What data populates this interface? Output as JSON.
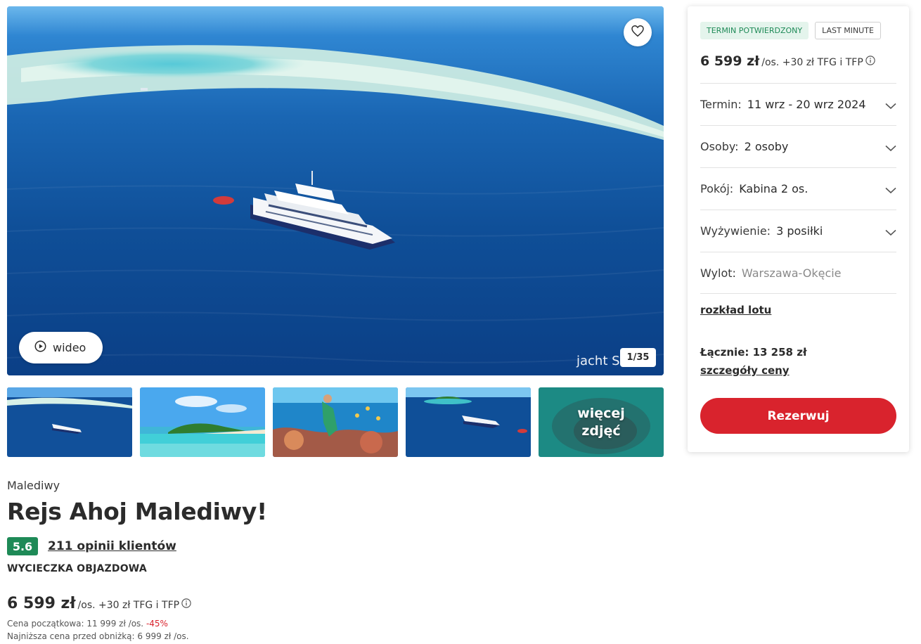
{
  "gallery": {
    "favorite_icon": "heart-icon",
    "video_icon": "play-circle-icon",
    "video_label": "wideo",
    "watermark": "jacht Sh",
    "counter": "1/35",
    "more_label": "więcej zdjęć",
    "thumbnails": [
      "yacht-aerial",
      "tropical-island",
      "snorkeling-reef",
      "yacht-near-island",
      "more-photos"
    ]
  },
  "listing": {
    "country": "Malediwy",
    "title": "Rejs Ahoj Malediwy!",
    "rating": "5.6",
    "reviews": "211 opinii klientów",
    "trip_type": "WYCIECZKA OBJAZDOWA",
    "price": "6 599 zł",
    "price_suffix": "/os. +30 zł TFG i TFP",
    "price_info_icon": "info-icon",
    "original_price": "Cena początkowa: 11 999 zł /os.",
    "discount": "-45%",
    "lowest_price": "Najniższa cena przed obniżką: 6 999 zł /os."
  },
  "booking": {
    "badge_confirmed": "TERMIN POTWIERDZONY",
    "badge_last_minute": "LAST MINUTE",
    "price": "6 599 zł",
    "price_suffix": "/os. +30 zł TFG i TFP",
    "options": [
      {
        "label": "Termin:",
        "value": "11 wrz - 20 wrz 2024",
        "dropdown": true
      },
      {
        "label": "Osoby:",
        "value": "2 osoby",
        "dropdown": true
      },
      {
        "label": "Pokój:",
        "value": "Kabina 2 os.",
        "dropdown": true
      },
      {
        "label": "Wyżywienie:",
        "value": "3 posiłki",
        "dropdown": true
      },
      {
        "label": "Wylot:",
        "value": "Warszawa-Okęcie",
        "dropdown": false
      }
    ],
    "flight_schedule_link": "rozkład lotu",
    "total": "Łącznie: 13 258 zł",
    "price_details_link": "szczegóły ceny",
    "reserve_label": "Rezerwuj"
  },
  "colors": {
    "accent_red": "#d9232d",
    "rating_green": "#1e8a57",
    "badge_green_bg": "#e4f4ec"
  }
}
